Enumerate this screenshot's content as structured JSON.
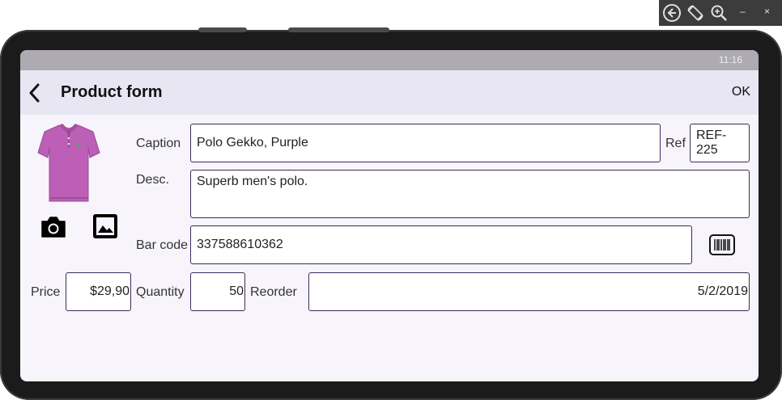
{
  "emulator": {
    "back_icon": "circle-arrow-left-icon",
    "rotate_icon": "rotate-device-icon",
    "zoom_icon": "zoom-in-icon",
    "minimize_label": "–",
    "close_label": "×"
  },
  "status_bar": {
    "time": "11:16"
  },
  "app_bar": {
    "back_icon": "chevron-left-icon",
    "title": "Product form",
    "ok_label": "OK"
  },
  "form": {
    "product_image": "purple-polo-shirt",
    "camera_icon": "camera-icon",
    "gallery_icon": "image-gallery-icon",
    "caption_label": "Caption",
    "caption_value": "Polo Gekko, Purple",
    "ref_label": "Ref",
    "ref_value": "REF-225",
    "desc_label": "Desc.",
    "desc_value": "Superb men's polo.",
    "barcode_label": "Bar code",
    "barcode_value": "337588610362",
    "barcode_icon": "barcode-scan-icon",
    "price_label": "Price",
    "price_value": "$29,90",
    "quantity_label": "Quantity",
    "quantity_value": "50",
    "reorder_label": "Reorder",
    "reorder_value": "5/2/2019"
  },
  "colors": {
    "status_bar": "#adaab3",
    "app_bar": "#e8e6f2",
    "screen_bg": "#f7f5fb",
    "field_border": "#3b2a5a",
    "shirt": "#bd5fb6"
  }
}
